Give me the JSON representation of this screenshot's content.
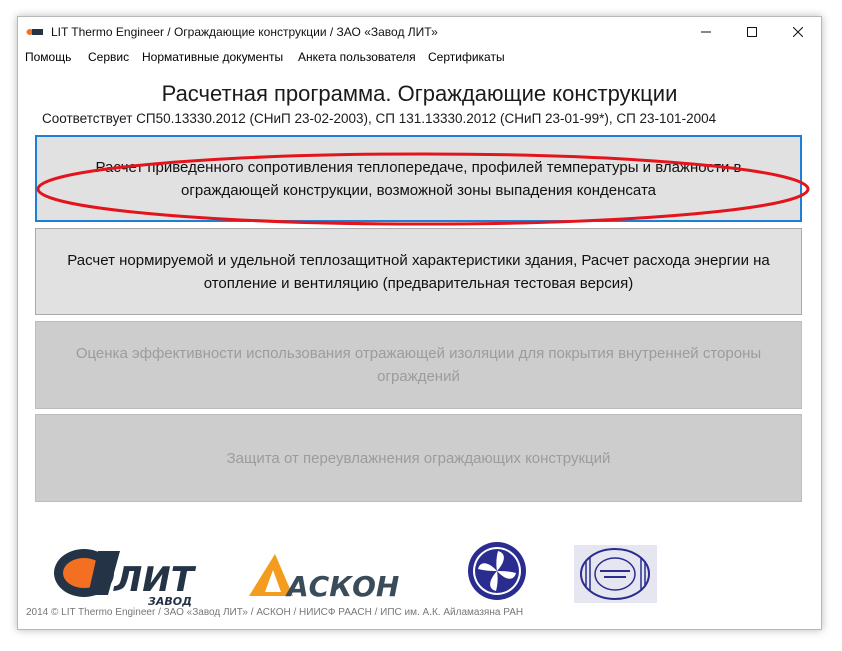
{
  "window": {
    "title": "LIT Thermo Engineer / Ограждающие конструкции / ЗАО «Завод ЛИТ»"
  },
  "menu": [
    "Помощь",
    "Сервис",
    "Нормативные документы",
    "Анкета пользователя",
    "Сертификаты"
  ],
  "heading": "Расчетная программа. Ограждающие конструкции",
  "subheading": "Соответствует СП50.13330.2012 (СНиП 23-02-2003), СП 131.13330.2012 (СНиП 23-01-99*), СП 23-101-2004",
  "options": [
    {
      "line1": "Расчет приведенного сопротивления теплопередаче, профилей температуры и влажности в",
      "line2": "ограждающей конструкции, возможной зоны выпадения конденсата",
      "state": "active"
    },
    {
      "line1": "Расчет нормируемой и удельной теплозащитной характеристики здания, Расчет расхода энергии на",
      "line2": "отопление и вентиляцию (предварительная тестовая версия)",
      "state": "enabled"
    },
    {
      "line1": "Оценка эффективности использования отражающей изоляции для покрытия внутренней стороны",
      "line2": "ограждений",
      "state": "disabled"
    },
    {
      "line1": "Защита от переувлажнения ограждающих конструкций",
      "line2": "",
      "state": "disabled"
    }
  ],
  "logos": {
    "lit": {
      "text": "ЛИТ",
      "subtext": "ЗАВОД"
    },
    "ascon": {
      "text": "АСКОН"
    },
    "niisf": {
      "text": ""
    },
    "ips": {
      "text": ""
    }
  },
  "footer": "2014 © LIT Thermo Engineer /  ЗАО «Завод ЛИТ» / АСКОН / НИИСФ РААСН / ИПС им. А.К. Айламазяна РАН",
  "colors": {
    "highlight_ellipse": "#e3141b",
    "active_border": "#1e7fd6",
    "lit_orange": "#f36f21",
    "lit_dark": "#243345",
    "ascon_orange": "#f39c1e",
    "niisf_blue": "#2a2d8f"
  }
}
